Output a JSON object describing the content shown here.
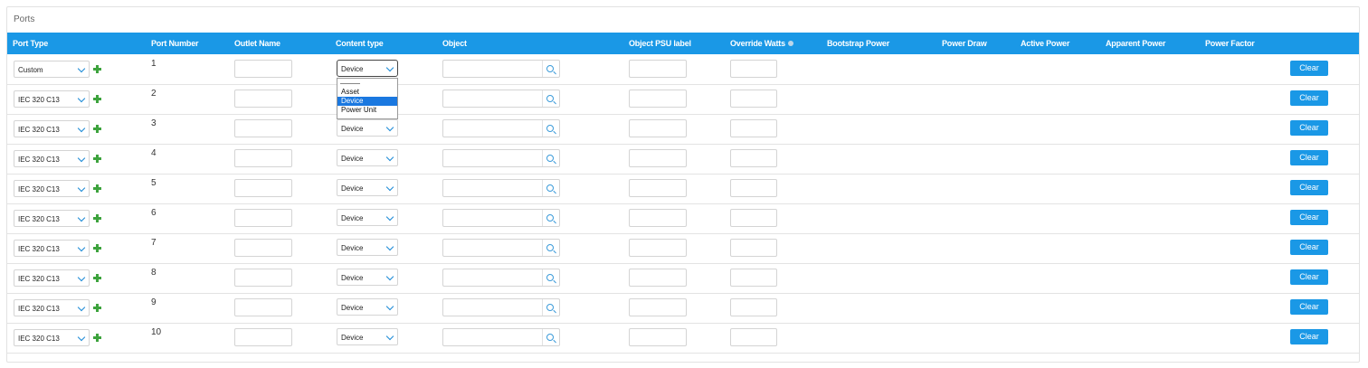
{
  "panel": {
    "title": "Ports"
  },
  "columns": {
    "port_type": "Port Type",
    "port_number": "Port Number",
    "outlet_name": "Outlet Name",
    "content_type": "Content type",
    "object": "Object",
    "object_psu_label": "Object PSU label",
    "override_watts": "Override Watts",
    "bootstrap_power": "Bootstrap Power",
    "power_draw": "Power Draw",
    "active_power": "Active Power",
    "apparent_power": "Apparent Power",
    "power_factor": "Power Factor"
  },
  "rows": [
    {
      "port_type": "Custom",
      "port_number": "1",
      "content_type": "Device",
      "clear_label": "Clear"
    },
    {
      "port_type": "IEC 320 C13",
      "port_number": "2",
      "content_type": "Device",
      "clear_label": "Clear"
    },
    {
      "port_type": "IEC 320 C13",
      "port_number": "3",
      "content_type": "Device",
      "clear_label": "Clear"
    },
    {
      "port_type": "IEC 320 C13",
      "port_number": "4",
      "content_type": "Device",
      "clear_label": "Clear"
    },
    {
      "port_type": "IEC 320 C13",
      "port_number": "5",
      "content_type": "Device",
      "clear_label": "Clear"
    },
    {
      "port_type": "IEC 320 C13",
      "port_number": "6",
      "content_type": "Device",
      "clear_label": "Clear"
    },
    {
      "port_type": "IEC 320 C13",
      "port_number": "7",
      "content_type": "Device",
      "clear_label": "Clear"
    },
    {
      "port_type": "IEC 320 C13",
      "port_number": "8",
      "content_type": "Device",
      "clear_label": "Clear"
    },
    {
      "port_type": "IEC 320 C13",
      "port_number": "9",
      "content_type": "Device",
      "clear_label": "Clear"
    },
    {
      "port_type": "IEC 320 C13",
      "port_number": "10",
      "content_type": "Device",
      "clear_label": "Clear"
    }
  ],
  "content_type_dropdown": {
    "separator": "--------",
    "options": [
      "Asset",
      "Device",
      "Power Unit"
    ],
    "selected": "Device"
  },
  "colors": {
    "header": "#1a98e6",
    "button": "#1a98e6",
    "add_icon": "#3da33d",
    "dropdown_highlight": "#1a78e0"
  },
  "icons": {
    "port_type_chevron": "chevron-down-icon",
    "add_port": "plus-icon",
    "object_search": "search-icon",
    "override_info": "info-icon"
  }
}
